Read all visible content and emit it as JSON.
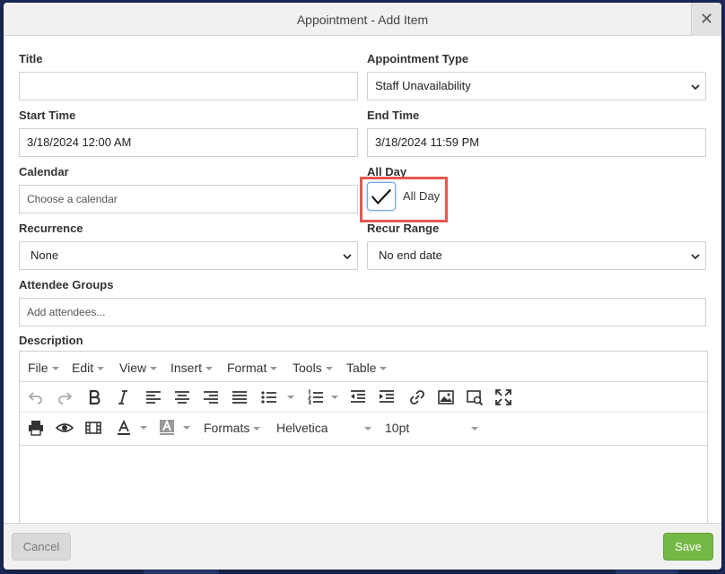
{
  "dialog": {
    "title": "Appointment - Add Item",
    "close_glyph": "✕"
  },
  "form": {
    "title": {
      "label": "Title",
      "value": ""
    },
    "appointment_type": {
      "label": "Appointment Type",
      "value": "Staff Unavailability"
    },
    "start_time": {
      "label": "Start Time",
      "value": "3/18/2024 12:00 AM"
    },
    "end_time": {
      "label": "End Time",
      "value": "3/18/2024 11:59 PM"
    },
    "calendar": {
      "label": "Calendar",
      "placeholder": "Choose a calendar"
    },
    "all_day": {
      "label": "All Day",
      "checkbox_label": "All Day",
      "checked": true
    },
    "recurrence": {
      "label": "Recurrence",
      "value": "None"
    },
    "recur_range": {
      "label": "Recur Range",
      "value": "No end date"
    },
    "attendee_groups": {
      "label": "Attendee Groups",
      "placeholder": "Add attendees..."
    },
    "description": {
      "label": "Description"
    }
  },
  "editor": {
    "menus": [
      "File",
      "Edit",
      "View",
      "Insert",
      "Format",
      "Tools",
      "Table"
    ],
    "formats_label": "Formats",
    "font_family": "Helvetica",
    "font_size": "10pt"
  },
  "footer": {
    "cancel_label": "Cancel",
    "save_label": "Save"
  },
  "colors": {
    "highlight": "#e8574d",
    "save": "#74b845"
  }
}
